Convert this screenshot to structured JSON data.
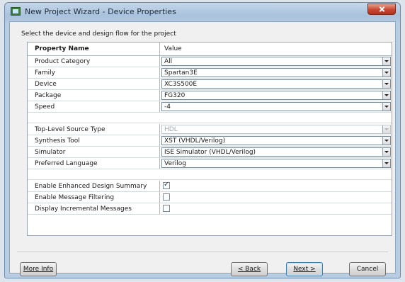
{
  "window": {
    "title": "New Project Wizard - Device Properties"
  },
  "instruction": "Select the device and design flow for the project",
  "grid": {
    "col_name": "Property Name",
    "col_value": "Value",
    "device_rows": [
      {
        "label": "Product Category",
        "value": "All"
      },
      {
        "label": "Family",
        "value": "Spartan3E"
      },
      {
        "label": "Device",
        "value": "XC3S500E"
      },
      {
        "label": "Package",
        "value": "FG320"
      },
      {
        "label": "Speed",
        "value": "-4"
      }
    ],
    "flow_rows": [
      {
        "label": "Top-Level Source Type",
        "value": "HDL",
        "disabled": true
      },
      {
        "label": "Synthesis Tool",
        "value": "XST (VHDL/Verilog)"
      },
      {
        "label": "Simulator",
        "value": "ISE Simulator (VHDL/Verilog)"
      },
      {
        "label": "Preferred Language",
        "value": "Verilog"
      }
    ],
    "option_rows": [
      {
        "label": "Enable Enhanced Design Summary",
        "checked": true
      },
      {
        "label": "Enable Message Filtering",
        "checked": false
      },
      {
        "label": "Display Incremental Messages",
        "checked": false
      }
    ]
  },
  "buttons": {
    "more_info": "More Info",
    "back": "< Back",
    "next": "Next >",
    "cancel": "Cancel"
  }
}
